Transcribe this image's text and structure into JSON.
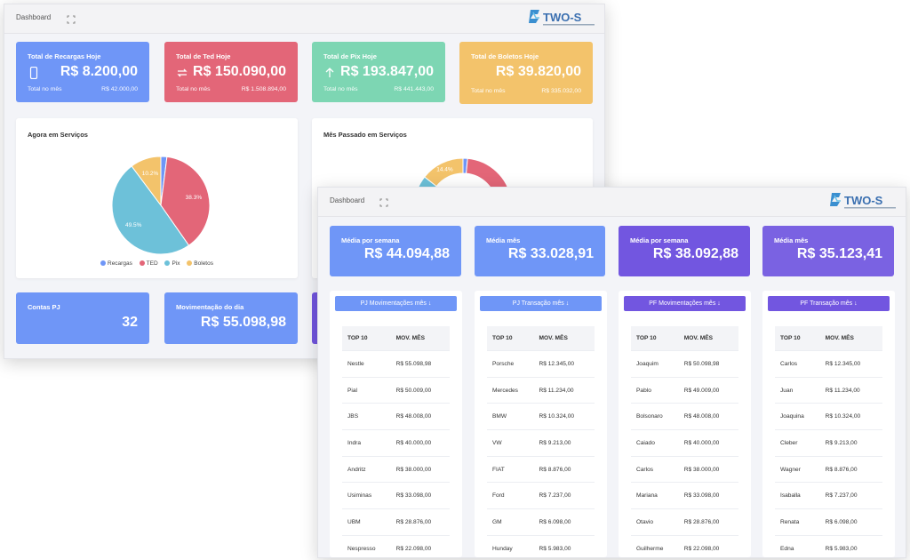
{
  "colors": {
    "blue": "#6f96f7",
    "red": "#e36678",
    "green": "#7dd6b3",
    "orange": "#f3c36b",
    "purple": "#7256e0",
    "cyan": "#6dc1d9"
  },
  "window1": {
    "breadcrumb": "Dashboard",
    "stats": [
      {
        "title": "Total de Recargas Hoje",
        "value": "R$ 8.200,00",
        "sub_label": "Total no mês",
        "sub_value": "R$ 42.000,00",
        "icon": "phone-icon",
        "color": "#6f96f7"
      },
      {
        "title": "Total de Ted Hoje",
        "value": "R$ 150.090,00",
        "sub_label": "Total no mês",
        "sub_value": "R$ 1.508.894,00",
        "icon": "transfer-icon",
        "color": "#e36678"
      },
      {
        "title": "Total de Pix Hoje",
        "value": "R$ 193.847,00",
        "sub_label": "Total no mês",
        "sub_value": "R$ 441.443,00",
        "icon": "arrow-up-icon",
        "color": "#7dd6b3"
      },
      {
        "title": "Total de Boletos Hoje",
        "value": "R$ 39.820,00",
        "sub_label": "Total no mês",
        "sub_value": "R$ 335.032,00",
        "icon": "none",
        "color": "#f3c36b"
      }
    ],
    "charts": {
      "now_title": "Agora em Serviços",
      "last_month_title": "Mês Passado em Serviços",
      "legend": [
        "Recargas",
        "TED",
        "Pix",
        "Boletos"
      ]
    },
    "bottom": [
      {
        "title": "Contas PJ",
        "value": "32"
      },
      {
        "title": "Movimentação do dia",
        "value": "R$ 55.098,98"
      }
    ]
  },
  "window2": {
    "breadcrumb": "Dashboard",
    "stats": [
      {
        "title": "Média por semana",
        "value": "R$ 44.094,88",
        "color": "#6f96f7"
      },
      {
        "title": "Média mês",
        "value": "R$ 33.028,91",
        "color": "#6f96f7"
      },
      {
        "title": "Média por semana",
        "value": "R$ 38.092,88",
        "color": "#7256e0"
      },
      {
        "title": "Média mês",
        "value": "R$ 35.123,41",
        "color": "#7a62e2"
      }
    ],
    "tables": [
      {
        "header": "PJ Movimentações mês ↓",
        "col1": "TOP 10",
        "col2": "MOV. MÊS",
        "color": "#6f96f7",
        "rows": [
          [
            "Nestle",
            "R$ 55.098,98"
          ],
          [
            "Pial",
            "R$ 50.009,00"
          ],
          [
            "JBS",
            "R$ 48.008,00"
          ],
          [
            "Indra",
            "R$ 40.000,00"
          ],
          [
            "Andritz",
            "R$ 38.000,00"
          ],
          [
            "Usiminas",
            "R$ 33.098,00"
          ],
          [
            "UBM",
            "R$ 28.876,00"
          ],
          [
            "Nespresso",
            "R$ 22.098,00"
          ]
        ]
      },
      {
        "header": "PJ Transação mês ↓",
        "col1": "TOP 10",
        "col2": "MOV. MÊS",
        "color": "#6f96f7",
        "rows": [
          [
            "Porsche",
            "R$ 12.345,00"
          ],
          [
            "Mercedes",
            "R$ 11.234,00"
          ],
          [
            "BMW",
            "R$ 10.324,00"
          ],
          [
            "VW",
            "R$ 9.213,00"
          ],
          [
            "FIAT",
            "R$ 8.876,00"
          ],
          [
            "Ford",
            "R$ 7.237,00"
          ],
          [
            "GM",
            "R$ 6.098,00"
          ],
          [
            "Hunday",
            "R$ 5.983,00"
          ]
        ]
      },
      {
        "header": "PF Movimentações mês ↓",
        "col1": "TOP 10",
        "col2": "MOV. MÊS",
        "color": "#7256e0",
        "rows": [
          [
            "Joaquim",
            "R$ 50.098,98"
          ],
          [
            "Pablo",
            "R$ 49.009,00"
          ],
          [
            "Bolsonaro",
            "R$ 48.008,00"
          ],
          [
            "Caiado",
            "R$ 40.000,00"
          ],
          [
            "Carlos",
            "R$ 38.000,00"
          ],
          [
            "Mariana",
            "R$ 33.098,00"
          ],
          [
            "Otavio",
            "R$ 28.876,00"
          ],
          [
            "Guilherme",
            "R$ 22.098,00"
          ]
        ]
      },
      {
        "header": "PF Transação mês ↓",
        "col1": "TOP 10",
        "col2": "MOV. MÊS",
        "color": "#7256e0",
        "rows": [
          [
            "Carlos",
            "R$ 12.345,00"
          ],
          [
            "Juan",
            "R$ 11.234,00"
          ],
          [
            "Joaquina",
            "R$ 10.324,00"
          ],
          [
            "Cleber",
            "R$ 9.213,00"
          ],
          [
            "Wagner",
            "R$ 8.876,00"
          ],
          [
            "Isaballa",
            "R$ 7.237,00"
          ],
          [
            "Renata",
            "R$ 6.098,00"
          ],
          [
            "Edna",
            "R$ 5.983,00"
          ]
        ]
      }
    ]
  },
  "chart_data": [
    {
      "type": "pie",
      "title": "Agora em Serviços",
      "categories": [
        "Recargas",
        "TED",
        "Pix",
        "Boletos"
      ],
      "values": [
        2.0,
        38.3,
        49.5,
        10.2
      ],
      "data_labels": [
        "",
        "38.3%",
        "49.5%",
        "10.2%"
      ],
      "colors": [
        "#6f96f7",
        "#e36678",
        "#6dc1d9",
        "#f3c36b"
      ],
      "legend": "bottom"
    },
    {
      "type": "pie",
      "title": "Mês Passado em Serviços",
      "categories": [
        "Recargas",
        "TED",
        "Pix",
        "Boletos"
      ],
      "values": [
        1.5,
        42.0,
        42.1,
        14.4
      ],
      "data_labels": [
        "",
        "",
        "",
        "14.4%"
      ],
      "colors": [
        "#6f96f7",
        "#e36678",
        "#6dc1d9",
        "#f3c36b"
      ],
      "donut": true
    }
  ]
}
